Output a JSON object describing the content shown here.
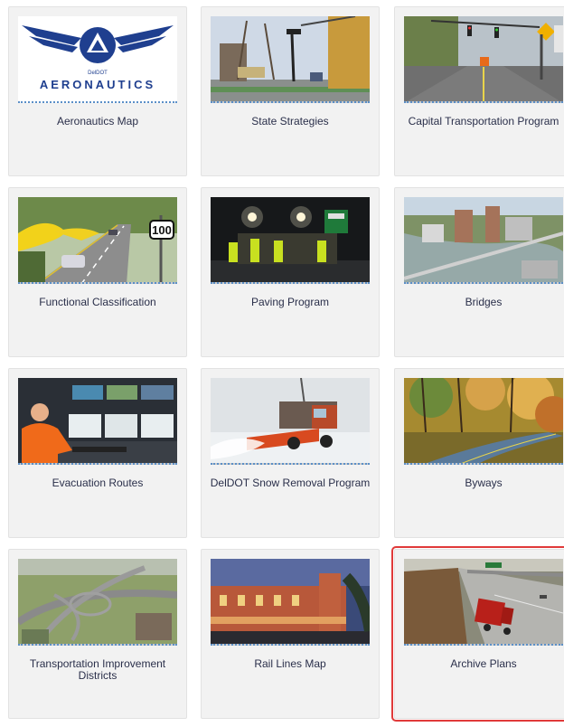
{
  "tiles": [
    {
      "label": "Aeronautics Map",
      "image": "deldot-aeronautics-logo",
      "logo_text_small": "DelDOT",
      "logo_text": "AERONAUTICS"
    },
    {
      "label": "State Strategies",
      "image": "city-street-crane"
    },
    {
      "label": "Capital Transportation Program",
      "image": "intersection-traffic-lights"
    },
    {
      "label": "Functional Classification",
      "image": "highway-route-100",
      "route_number": "100"
    },
    {
      "label": "Paving Program",
      "image": "night-paving-crew"
    },
    {
      "label": "Bridges",
      "image": "aerial-river-bridge"
    },
    {
      "label": "Evacuation Routes",
      "image": "traffic-control-room"
    },
    {
      "label": "DelDOT Snow Removal Program",
      "image": "snow-plow-truck"
    },
    {
      "label": "Byways",
      "image": "autumn-forest-road"
    },
    {
      "label": "Transportation Improvement Districts",
      "image": "aerial-highway-interchange"
    },
    {
      "label": "Rail Lines Map",
      "image": "brick-train-station"
    },
    {
      "label": "Archive Plans",
      "image": "highway-dump-truck",
      "selected": true
    }
  ],
  "colors": {
    "tile_bg": "#f2f2f2",
    "label_text": "#2a2f4a",
    "selected_outline": "#e03a3a",
    "thumb_underline": "#5b8fc7",
    "logo_blue": "#1f3f8f"
  }
}
